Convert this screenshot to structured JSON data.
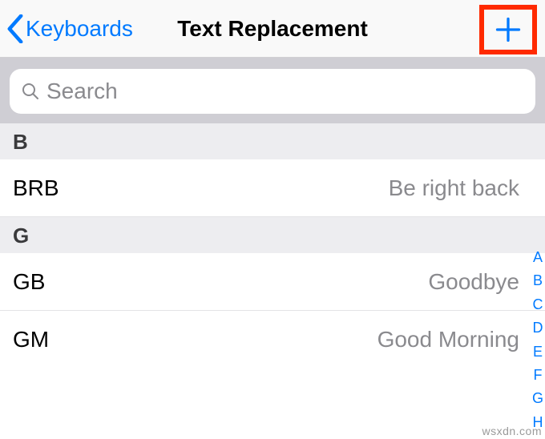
{
  "nav": {
    "back_label": "Keyboards",
    "title": "Text Replacement"
  },
  "search": {
    "placeholder": "Search"
  },
  "sections": [
    {
      "letter": "B",
      "items": [
        {
          "shortcut": "BRB",
          "phrase": "Be right back"
        }
      ]
    },
    {
      "letter": "G",
      "items": [
        {
          "shortcut": "GB",
          "phrase": "Goodbye"
        },
        {
          "shortcut": "GM",
          "phrase": "Good Morning"
        }
      ]
    }
  ],
  "index": [
    "A",
    "B",
    "C",
    "D",
    "E",
    "F",
    "G",
    "H"
  ],
  "watermark": "wsxdn.com"
}
